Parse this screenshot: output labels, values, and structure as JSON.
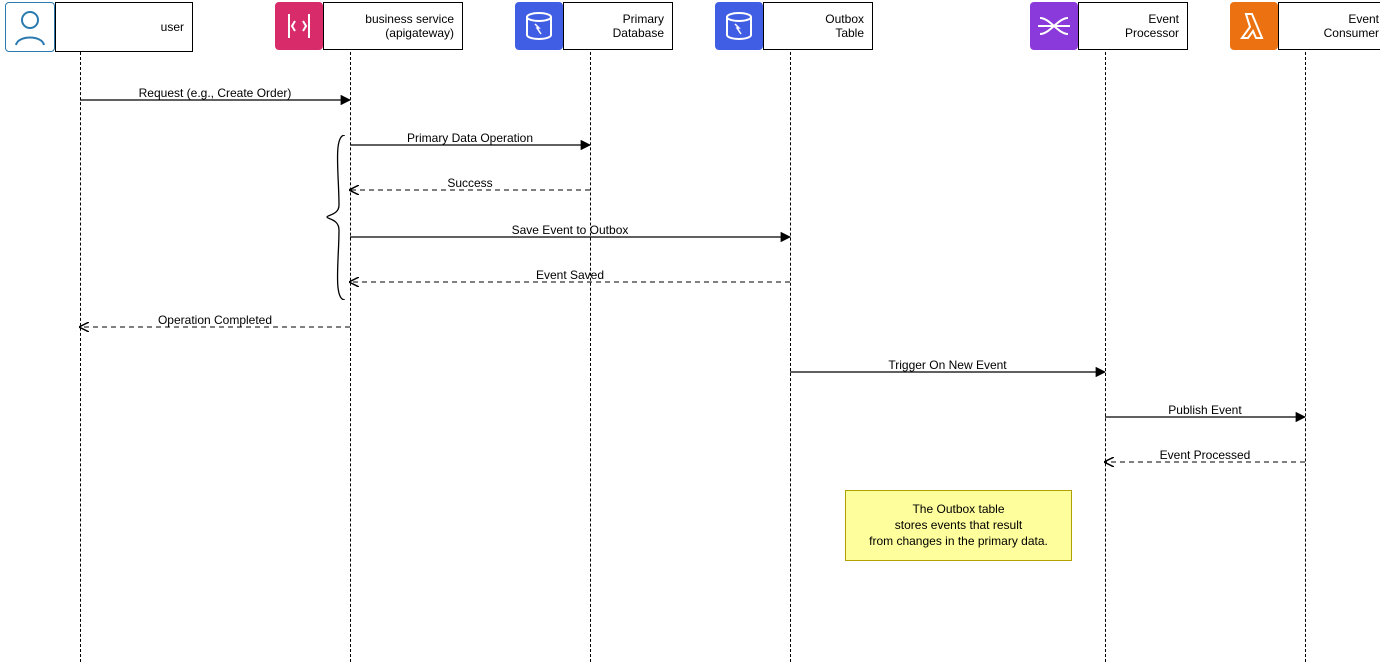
{
  "participants": {
    "user": {
      "label1": "user",
      "label2": ""
    },
    "apigw": {
      "label1": "business service",
      "label2": "(apigateway)"
    },
    "db": {
      "label1": "Primary",
      "label2": "Database"
    },
    "outbox": {
      "label1": "Outbox",
      "label2": "Table"
    },
    "processor": {
      "label1": "Event",
      "label2": "Processor"
    },
    "consumer": {
      "label1": "Event",
      "label2": "Consumer"
    }
  },
  "messages": {
    "m1": "Request (e.g., Create Order)",
    "m2": "Primary Data Operation",
    "m3": "Success",
    "m4": "Save Event to Outbox",
    "m5": "Event Saved",
    "m6": "Operation Completed",
    "m7": "Trigger On New Event",
    "m8": "Publish Event",
    "m9": "Event Processed"
  },
  "note": {
    "line1": "The Outbox table",
    "line2": "stores events that result",
    "line3": "from changes in the primary data."
  }
}
